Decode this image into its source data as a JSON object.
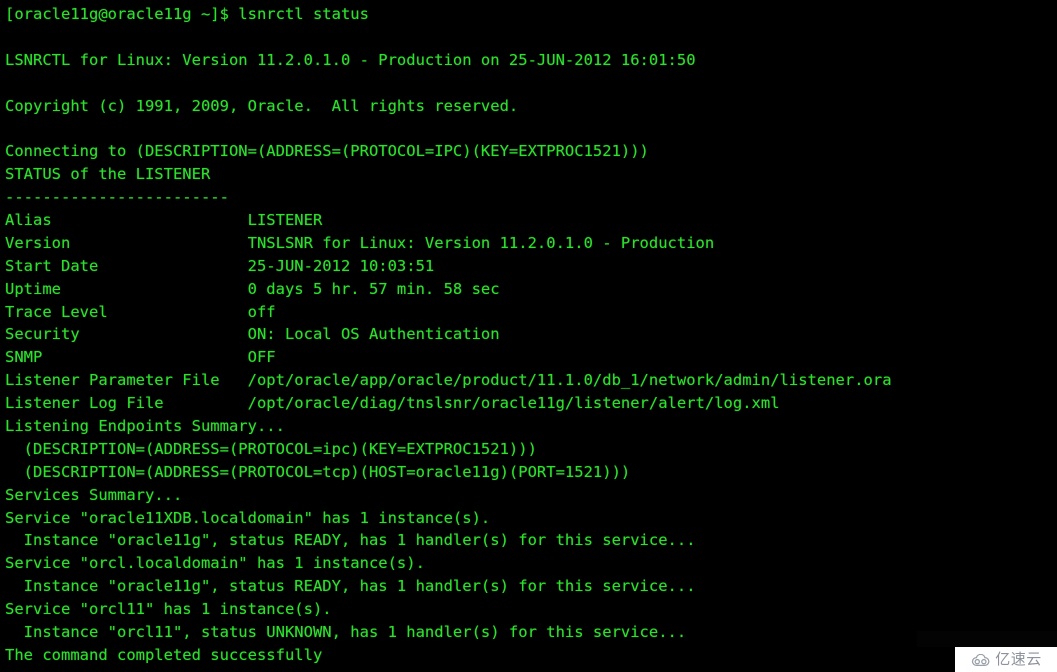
{
  "terminal": {
    "title": "lsnrctl status",
    "background_color": "#000000",
    "foreground_color": "#2ee02e",
    "prompt_user": "oracle11g",
    "prompt_host": "oracle11g",
    "prompt_cwd": "~",
    "prompt_symbol": "$",
    "command": "lsnrctl status",
    "lines": [
      "[oracle11g@oracle11g ~]$ lsnrctl status",
      "",
      "LSNRCTL for Linux: Version 11.2.0.1.0 - Production on 25-JUN-2012 16:01:50",
      "",
      "Copyright (c) 1991, 2009, Oracle.  All rights reserved.",
      "",
      "Connecting to (DESCRIPTION=(ADDRESS=(PROTOCOL=IPC)(KEY=EXTPROC1521)))",
      "STATUS of the LISTENER",
      "------------------------",
      "Alias                     LISTENER",
      "Version                   TNSLSNR for Linux: Version 11.2.0.1.0 - Production",
      "Start Date                25-JUN-2012 10:03:51",
      "Uptime                    0 days 5 hr. 57 min. 58 sec",
      "Trace Level               off",
      "Security                  ON: Local OS Authentication",
      "SNMP                      OFF",
      "Listener Parameter File   /opt/oracle/app/oracle/product/11.1.0/db_1/network/admin/listener.ora",
      "Listener Log File         /opt/oracle/diag/tnslsnr/oracle11g/listener/alert/log.xml",
      "Listening Endpoints Summary...",
      "  (DESCRIPTION=(ADDRESS=(PROTOCOL=ipc)(KEY=EXTPROC1521)))",
      "  (DESCRIPTION=(ADDRESS=(PROTOCOL=tcp)(HOST=oracle11g)(PORT=1521)))",
      "Services Summary...",
      "Service \"oracle11XDB.localdomain\" has 1 instance(s).",
      "  Instance \"oracle11g\", status READY, has 1 handler(s) for this service...",
      "Service \"orcl.localdomain\" has 1 instance(s).",
      "  Instance \"oracle11g\", status READY, has 1 handler(s) for this service...",
      "Service \"orcl11\" has 1 instance(s).",
      "  Instance \"orcl11\", status UNKNOWN, has 1 handler(s) for this service...",
      "The command completed successfully"
    ]
  },
  "listener_status": {
    "banner": "LSNRCTL for Linux: Version 11.2.0.1.0 - Production on 25-JUN-2012 16:01:50",
    "copyright": "Copyright (c) 1991, 2009, Oracle.  All rights reserved.",
    "connecting_to": "Connecting to (DESCRIPTION=(ADDRESS=(PROTOCOL=IPC)(KEY=EXTPROC1521)))",
    "section_title": "STATUS of the LISTENER",
    "separator": "------------------------",
    "fields": [
      {
        "label": "Alias",
        "value": "LISTENER"
      },
      {
        "label": "Version",
        "value": "TNSLSNR for Linux: Version 11.2.0.1.0 - Production"
      },
      {
        "label": "Start Date",
        "value": "25-JUN-2012 10:03:51"
      },
      {
        "label": "Uptime",
        "value": "0 days 5 hr. 57 min. 58 sec"
      },
      {
        "label": "Trace Level",
        "value": "off"
      },
      {
        "label": "Security",
        "value": "ON: Local OS Authentication"
      },
      {
        "label": "SNMP",
        "value": "OFF"
      },
      {
        "label": "Listener Parameter File",
        "value": "/opt/oracle/app/oracle/product/11.1.0/db_1/network/admin/listener.ora"
      },
      {
        "label": "Listener Log File",
        "value": "/opt/oracle/diag/tnslsnr/oracle11g/listener/alert/log.xml"
      }
    ],
    "endpoints_heading": "Listening Endpoints Summary...",
    "endpoints": [
      "  (DESCRIPTION=(ADDRESS=(PROTOCOL=ipc)(KEY=EXTPROC1521)))",
      "  (DESCRIPTION=(ADDRESS=(PROTOCOL=tcp)(HOST=oracle11g)(PORT=1521)))"
    ],
    "services_heading": "Services Summary...",
    "services": [
      {
        "service_line": "Service \"oracle11XDB.localdomain\" has 1 instance(s).",
        "instance_line": "  Instance \"oracle11g\", status READY, has 1 handler(s) for this service..."
      },
      {
        "service_line": "Service \"orcl.localdomain\" has 1 instance(s).",
        "instance_line": "  Instance \"oracle11g\", status READY, has 1 handler(s) for this service..."
      },
      {
        "service_line": "Service \"orcl11\" has 1 instance(s).",
        "instance_line": "  Instance \"orcl11\", status UNKNOWN, has 1 handler(s) for this service..."
      }
    ],
    "footer": "The command completed successfully"
  },
  "watermark": {
    "text": "亿速云",
    "icon": "cloud-icon",
    "text_color": "#8d929b",
    "background_color": "#ffffff"
  }
}
